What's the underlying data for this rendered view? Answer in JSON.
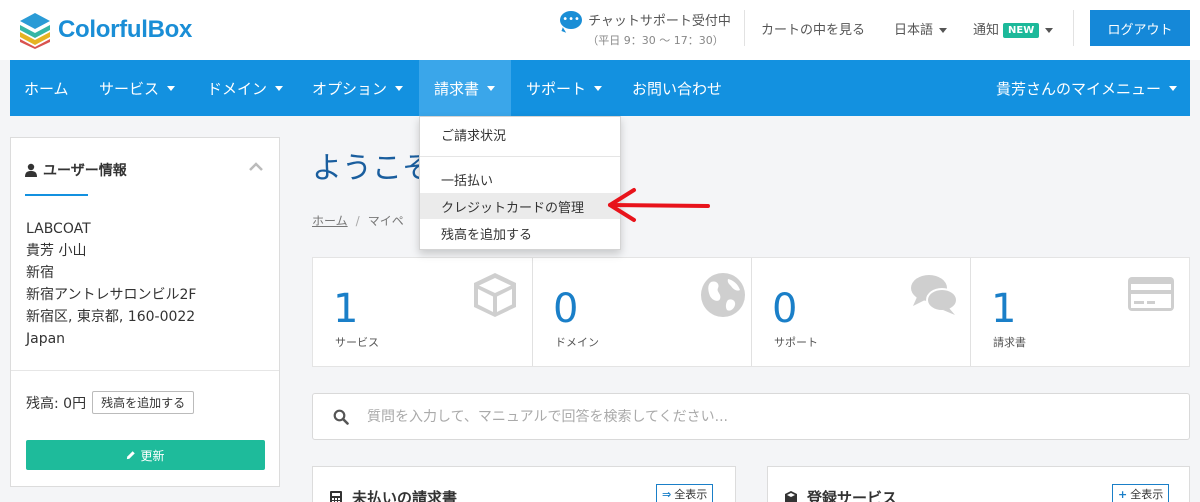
{
  "header": {
    "logo_text": "ColorfulBox",
    "chat_support": "チャットサポート受付中",
    "chat_hours": "（平日 9：30 ～ 17：30）",
    "cart_link": "カートの中を見る",
    "language": "日本語",
    "notifications": "通知",
    "new_badge": "NEW",
    "logout": "ログアウト"
  },
  "nav": {
    "items": [
      {
        "label": "ホーム"
      },
      {
        "label": "サービス"
      },
      {
        "label": "ドメイン"
      },
      {
        "label": "オプション"
      },
      {
        "label": "請求書"
      },
      {
        "label": "サポート"
      },
      {
        "label": "お問い合わせ"
      }
    ],
    "my_menu": "貴芳さんのマイメニュー"
  },
  "dropdown": {
    "items": [
      {
        "label": "ご請求状況"
      },
      {
        "label": "一括払い"
      },
      {
        "label": "クレジットカードの管理"
      },
      {
        "label": "残高を追加する"
      }
    ]
  },
  "sidebar": {
    "title": "ユーザー情報",
    "address_lines": [
      "LABCOAT",
      "貴芳 小山",
      "新宿",
      "新宿アントレサロンビル2F",
      "新宿区, 東京都, 160-0022",
      "Japan"
    ],
    "balance_label": "残高: 0円",
    "add_balance_button": "残高を追加する",
    "refresh_button": "更新"
  },
  "main": {
    "welcome_title": "ようこそ",
    "breadcrumb": {
      "home": "ホーム",
      "current": "マイペ"
    },
    "stats": [
      {
        "value": "1",
        "label": "サービス",
        "icon": "box-icon"
      },
      {
        "value": "0",
        "label": "ドメイン",
        "icon": "globe-icon"
      },
      {
        "value": "0",
        "label": "サポート",
        "icon": "chat-bubbles-icon"
      },
      {
        "value": "1",
        "label": "請求書",
        "icon": "credit-card-icon"
      }
    ],
    "search_placeholder": "質問を入力して、マニュアルで回答を検索してください...",
    "cards": [
      {
        "title": "未払いの請求書",
        "button": "全表示"
      },
      {
        "title": "登録サービス",
        "button": "全表示"
      }
    ]
  },
  "colors": {
    "brand_blue": "#1391e0",
    "nav_active": "#3aa6ea",
    "accent_green": "#1ebb9b",
    "annotation_red": "#e8131b"
  }
}
